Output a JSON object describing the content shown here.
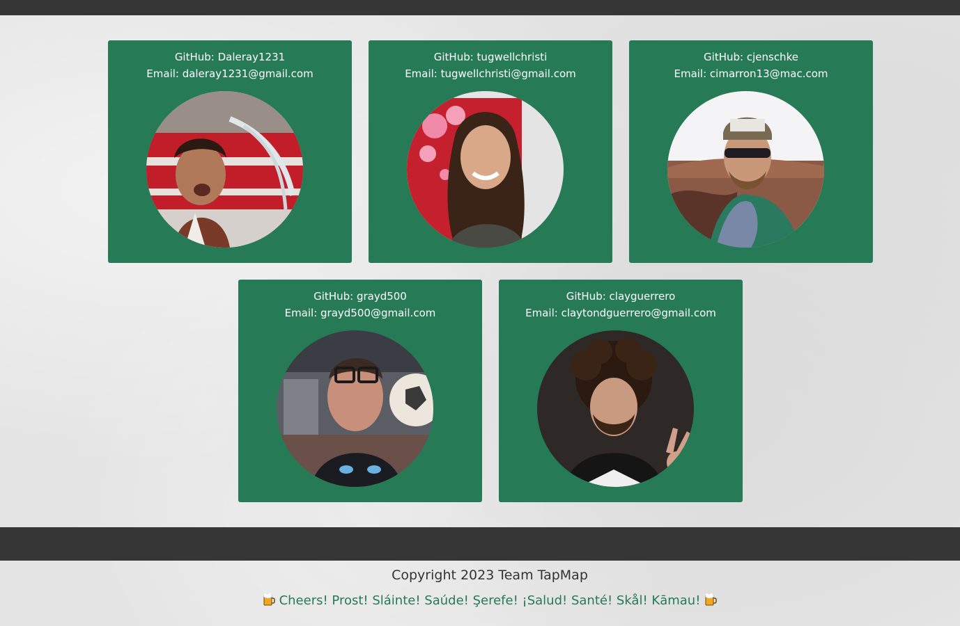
{
  "team": [
    {
      "github": "GitHub: Daleray1231",
      "email": "Email: daleray1231@gmail.com",
      "avatar_icon": "avatar-photo"
    },
    {
      "github": "GitHub: tugwellchristi",
      "email": "Email: tugwellchristi@gmail.com",
      "avatar_icon": "avatar-photo"
    },
    {
      "github": "GitHub: cjenschke",
      "email": "Email: cimarron13@mac.com",
      "avatar_icon": "avatar-photo"
    },
    {
      "github": "GitHub: grayd500",
      "email": "Email: grayd500@gmail.com",
      "avatar_icon": "avatar-photo"
    },
    {
      "github": "GitHub: clayguerrero",
      "email": "Email: claytondguerrero@gmail.com",
      "avatar_icon": "avatar-photo"
    }
  ],
  "footer": {
    "copyright": "Copyright 2023 Team TapMap",
    "cheers": "Cheers! Prost! Sláinte! Saúde! Şerefe! ¡Salud! Santé! Skål! Kāmau!",
    "cheers_icon": "beer-mug-icon"
  },
  "colors": {
    "card": "#267a55",
    "bar": "#363636",
    "cheers_text": "#267a55"
  }
}
